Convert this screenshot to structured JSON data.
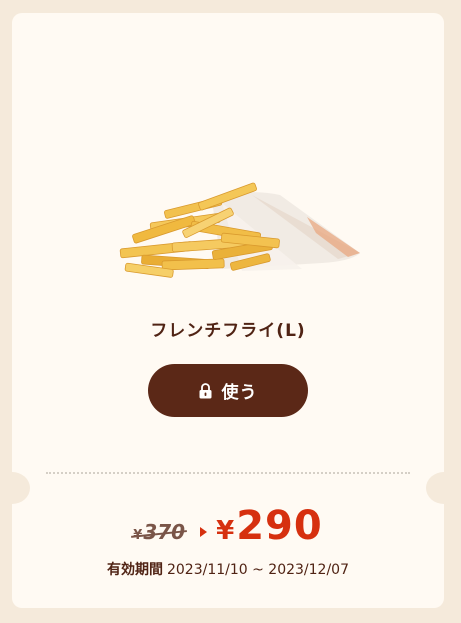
{
  "product": {
    "name": "フレンチフライ(L)",
    "image_icon": "french-fries-image"
  },
  "use_button": {
    "label": "使う",
    "icon": "lock-icon"
  },
  "price": {
    "old_currency": "¥",
    "old_amount": "370",
    "new_currency": "¥",
    "new_amount": "290"
  },
  "validity": {
    "label": "有効期間",
    "range": "2023/11/10 ~ 2023/12/07"
  },
  "colors": {
    "background": "#f5eadb",
    "card": "#fffaf3",
    "brand_brown": "#5b2817",
    "text_brown": "#502314",
    "price_red": "#d6300f"
  }
}
